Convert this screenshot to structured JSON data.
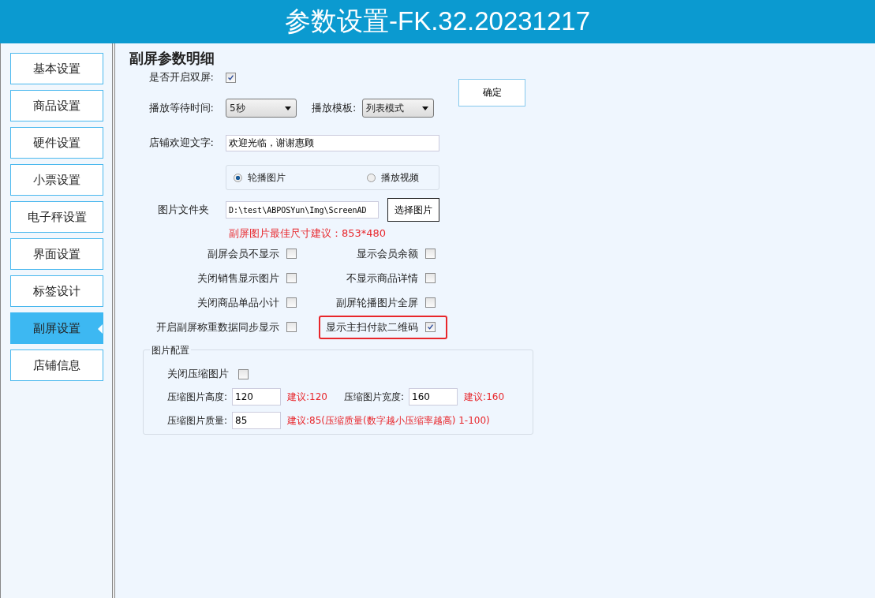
{
  "window": {
    "title": "参数设置-FK.32.20231217"
  },
  "sidebar": {
    "items": [
      {
        "label": "基本设置",
        "selected": false
      },
      {
        "label": "商品设置",
        "selected": false
      },
      {
        "label": "硬件设置",
        "selected": false
      },
      {
        "label": "小票设置",
        "selected": false
      },
      {
        "label": "电子秤设置",
        "selected": false
      },
      {
        "label": "界面设置",
        "selected": false
      },
      {
        "label": "标签设计",
        "selected": false
      },
      {
        "label": "副屏设置",
        "selected": true
      },
      {
        "label": "店铺信息",
        "selected": false
      }
    ]
  },
  "section": {
    "title": "副屏参数明细",
    "dual_screen": {
      "label": "是否开启双屏:",
      "checked": true
    },
    "confirm_button": "确定",
    "wait_time": {
      "label": "播放等待时间:",
      "value": "5秒"
    },
    "template": {
      "label": "播放模板:",
      "value": "列表模式"
    },
    "welcome": {
      "label": "店铺欢迎文字:",
      "value": "欢迎光临，谢谢惠顾"
    },
    "media": [
      {
        "label": "轮播图片",
        "selected": true
      },
      {
        "label": "播放视频",
        "selected": false
      }
    ],
    "folder": {
      "label": "图片文件夹",
      "value": "D:\\test\\ABPOSYun\\Img\\ScreenAD",
      "button": "选择图片"
    },
    "size_hint": "副屏图片最佳尺寸建议：853*480",
    "toggles": [
      {
        "label": "副屏会员不显示",
        "checked": false,
        "highlighted": false
      },
      {
        "label": "显示会员余额",
        "checked": false,
        "highlighted": false
      },
      {
        "label": "关闭销售显示图片",
        "checked": false,
        "highlighted": false
      },
      {
        "label": "不显示商品详情",
        "checked": false,
        "highlighted": false
      },
      {
        "label": "关闭商品单品小计",
        "checked": false,
        "highlighted": false
      },
      {
        "label": "副屏轮播图片全屏",
        "checked": false,
        "highlighted": false
      },
      {
        "label": "开启副屏称重数据同步显示",
        "checked": false,
        "highlighted": false
      },
      {
        "label": "显示主扫付款二维码",
        "checked": true,
        "highlighted": true
      }
    ],
    "image_config": {
      "title": "图片配置",
      "close_compress": {
        "label": "关闭压缩图片",
        "checked": false
      },
      "height": {
        "label": "压缩图片高度:",
        "value": "120",
        "hint": "建议:120"
      },
      "width": {
        "label": "压缩图片宽度:",
        "value": "160",
        "hint": "建议:160"
      },
      "quality": {
        "label": "压缩图片质量:",
        "value": "85",
        "hint": "建议:85(压缩质量(数字越小压缩率越高) 1-100)"
      }
    }
  }
}
